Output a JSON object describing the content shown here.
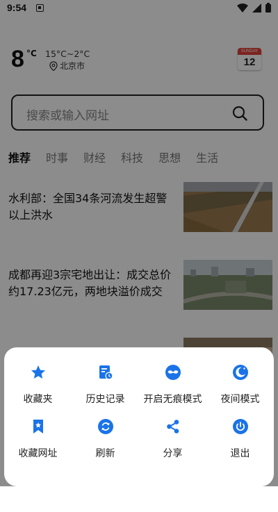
{
  "status": {
    "time": "9:54"
  },
  "weather": {
    "temperature": "8",
    "unit": "°C",
    "range": "15°C~2°C",
    "city": "北京市",
    "calendar_top": "SUNDAY",
    "calendar_day": "12"
  },
  "search": {
    "placeholder": "搜索或输入网址"
  },
  "tabs": [
    "推荐",
    "时事",
    "财经",
    "科技",
    "思想",
    "生活"
  ],
  "news": [
    {
      "title": "水利部：全国34条河流发生超警以上洪水"
    },
    {
      "title": "成都再迎3宗宅地出让：成交总价约17.23亿元，两地块溢价成交"
    }
  ],
  "menu": [
    {
      "label": "收藏夹",
      "icon": "star-icon"
    },
    {
      "label": "历史记录",
      "icon": "history-icon"
    },
    {
      "label": "开启无痕模式",
      "icon": "incognito-mask-icon"
    },
    {
      "label": "夜间模式",
      "icon": "night-mode-icon"
    },
    {
      "label": "收藏网址",
      "icon": "bookmark-icon"
    },
    {
      "label": "刷新",
      "icon": "refresh-icon"
    },
    {
      "label": "分享",
      "icon": "share-icon"
    },
    {
      "label": "退出",
      "icon": "power-icon"
    }
  ],
  "colors": {
    "accent": "#1a73e8",
    "overlay": "#000000"
  }
}
